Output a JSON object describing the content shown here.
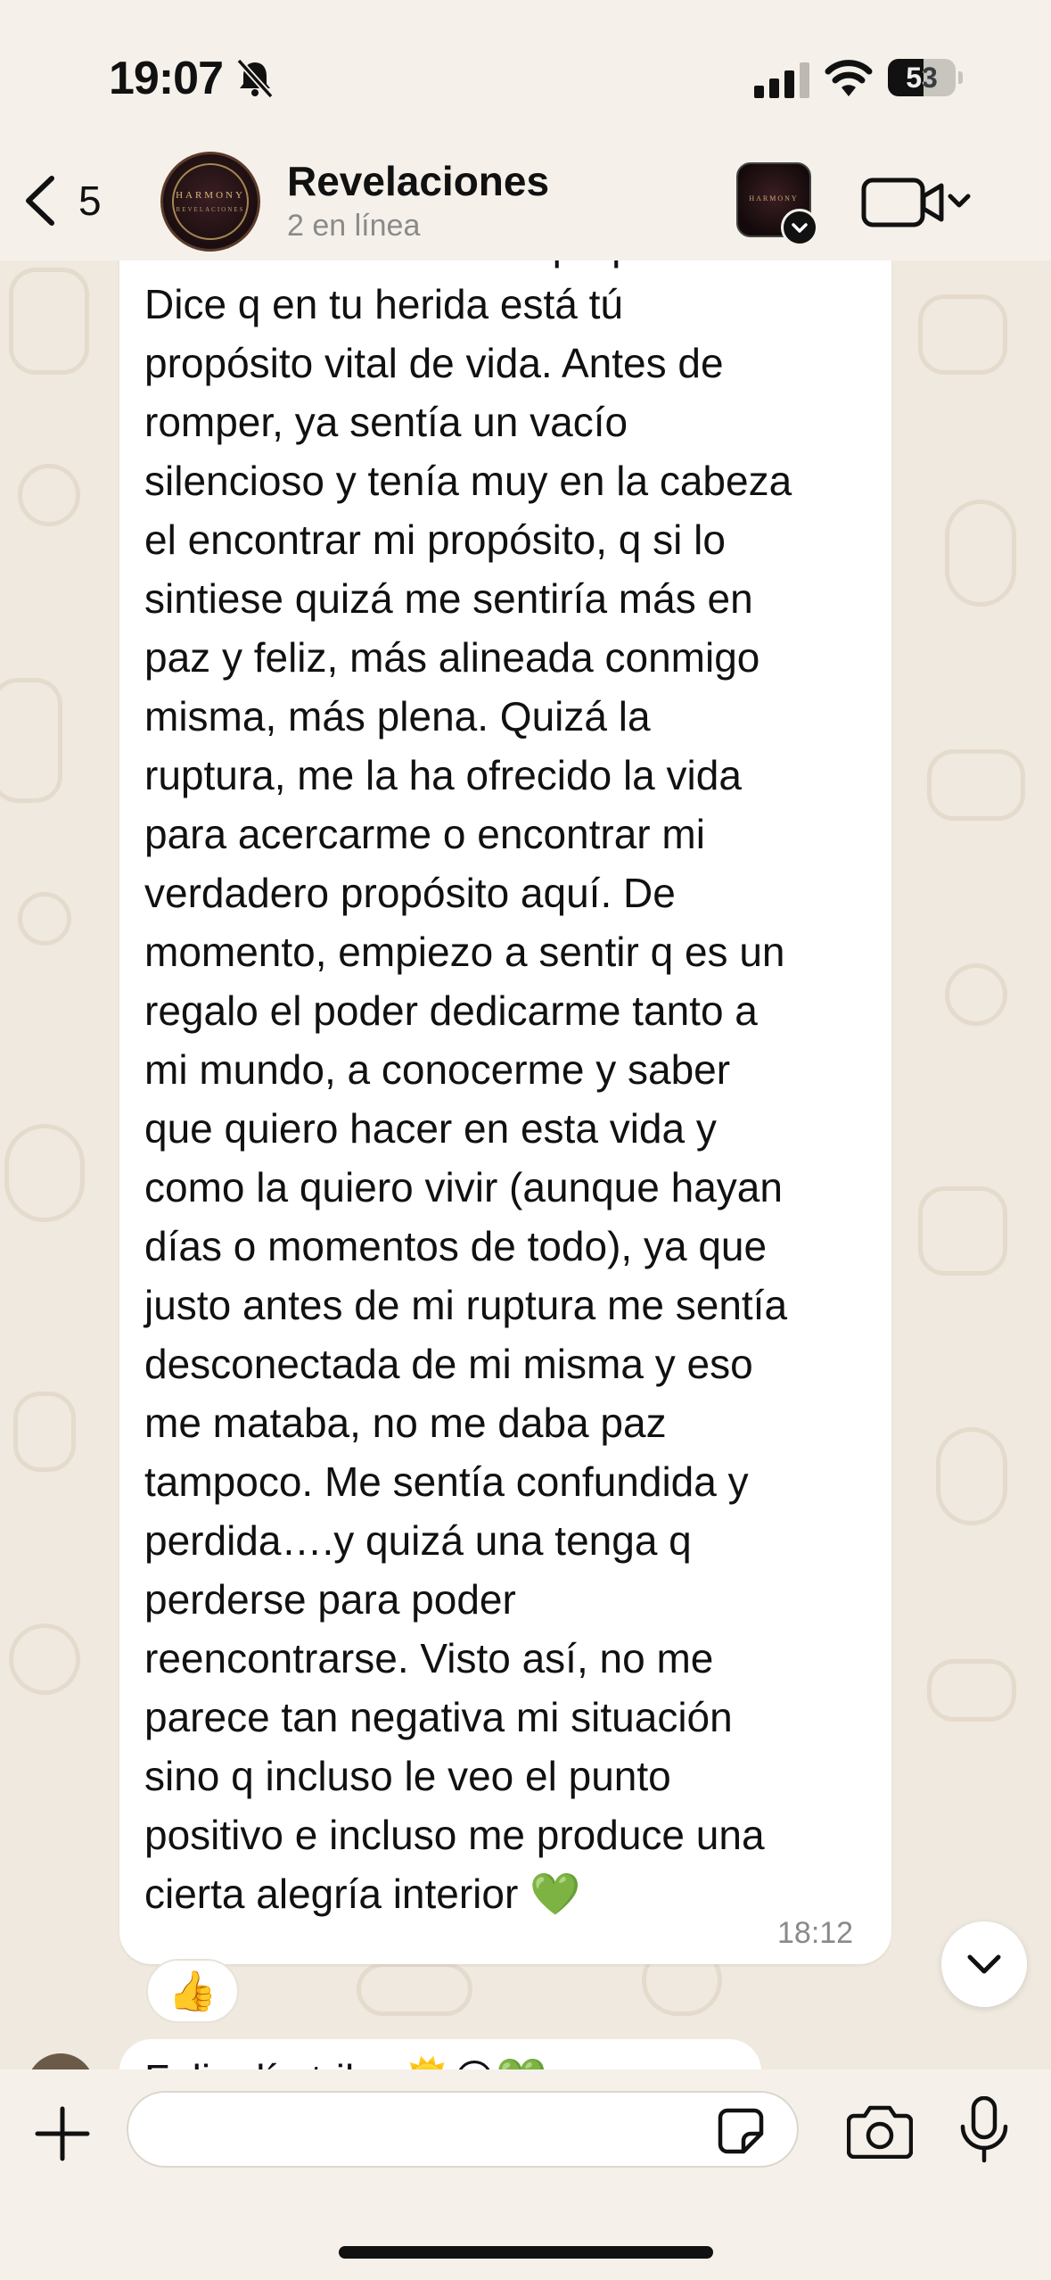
{
  "status_bar": {
    "time": "19:07",
    "battery_level": "53",
    "icons": [
      "bell-slash-icon",
      "signal-icon",
      "wifi-icon",
      "battery-icon"
    ]
  },
  "header": {
    "back_count": "5",
    "chat_name": "Revelaciones",
    "subtitle": "2 en línea",
    "avatar_text_main": "HARMONY",
    "avatar_text_sub": "REVELACIONES",
    "thumb_text": "HARMONY"
  },
  "message": {
    "lines": [
      "aflorase mi verdadero propósito?",
      "Dice q en tu herida está tú",
      "propósito vital de vida. Antes de",
      "romper, ya sentía un vacío",
      "silencioso y tenía muy en la cabeza",
      "el encontrar mi propósito, q si lo",
      "sintiese quizá me sentiría más en",
      "paz y feliz, más alineada conmigo",
      "misma, más plena. Quizá la",
      "ruptura, me la ha ofrecido la vida",
      "para acercarme o encontrar mi",
      "verdadero propósito aquí. De",
      "momento, empiezo a sentir q es un",
      "regalo el poder dedicarme tanto a",
      "mi mundo, a conocerme y saber",
      "que quiero hacer en esta vida y",
      "como la quiero vivir (aunque hayan",
      "días o momentos de todo), ya que",
      "justo antes de mi ruptura me sentía",
      "desconectada de mi misma y eso",
      "me mataba, no me daba paz",
      "tampoco. Me sentía confundida y",
      "perdida….y quizá una tenga q",
      "perderse para poder",
      "reencontrarse. Visto así, no me",
      "parece tan negativa mi situación",
      "sino q incluso le veo el punto",
      "positivo e incluso me produce una",
      "cierta alegría interior 💚"
    ],
    "time": "18:12",
    "reaction": "👍"
  },
  "next_message": {
    "preview": "Feliz día tribu 🌞🌕💚"
  },
  "input": {
    "placeholder": ""
  },
  "colors": {
    "chat_background": "#efe9df",
    "bubble": "#ffffff",
    "secondary_text": "#8a8a8a"
  }
}
